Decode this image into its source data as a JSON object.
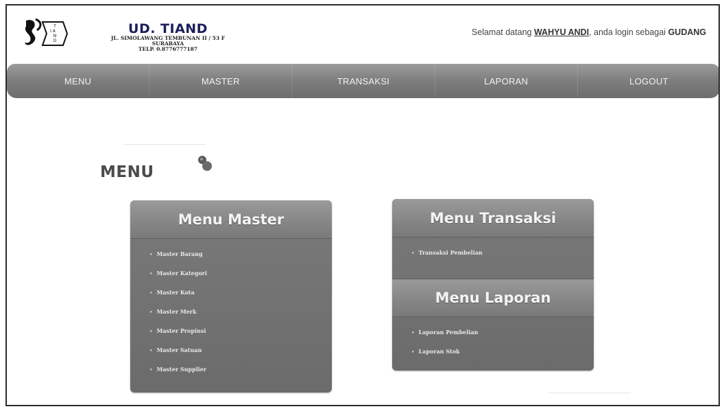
{
  "header": {
    "company_name": "UD. TIAND",
    "company_address": "JL. SIMOLAWANG TEMBUNAN II / 53 F",
    "company_city": "SURABAYA",
    "company_phone": "TELP. 0.8776777187",
    "logo_letters": "T I A N D"
  },
  "welcome": {
    "prefix": "Selamat datang",
    "user": "WAHYU ANDI",
    "middle": ", anda login sebagai",
    "role": "GUDANG"
  },
  "nav": {
    "items": [
      "MENU",
      "MASTER",
      "TRANSAKSI",
      "LAPORAN",
      "LOGOUT"
    ]
  },
  "page": {
    "title": "MENU"
  },
  "menu_master": {
    "title": "Menu Master",
    "items": [
      "Master Barang",
      "Master Kategori",
      "Master Kota",
      "Master Merk",
      "Master Propinsi",
      "Master Satuan",
      "Master Supplier"
    ]
  },
  "menu_transaksi": {
    "title": "Menu Transaksi",
    "items": [
      "Transaksi Pembelian"
    ]
  },
  "menu_laporan": {
    "title": "Menu Laporan",
    "items": [
      "Laporan Pembelian",
      "Laporan Stok"
    ]
  },
  "colors": {
    "nav_bg": "#7d7d7d",
    "panel_bg": "#6b6b6b",
    "company_name": "#1b1f5a"
  }
}
